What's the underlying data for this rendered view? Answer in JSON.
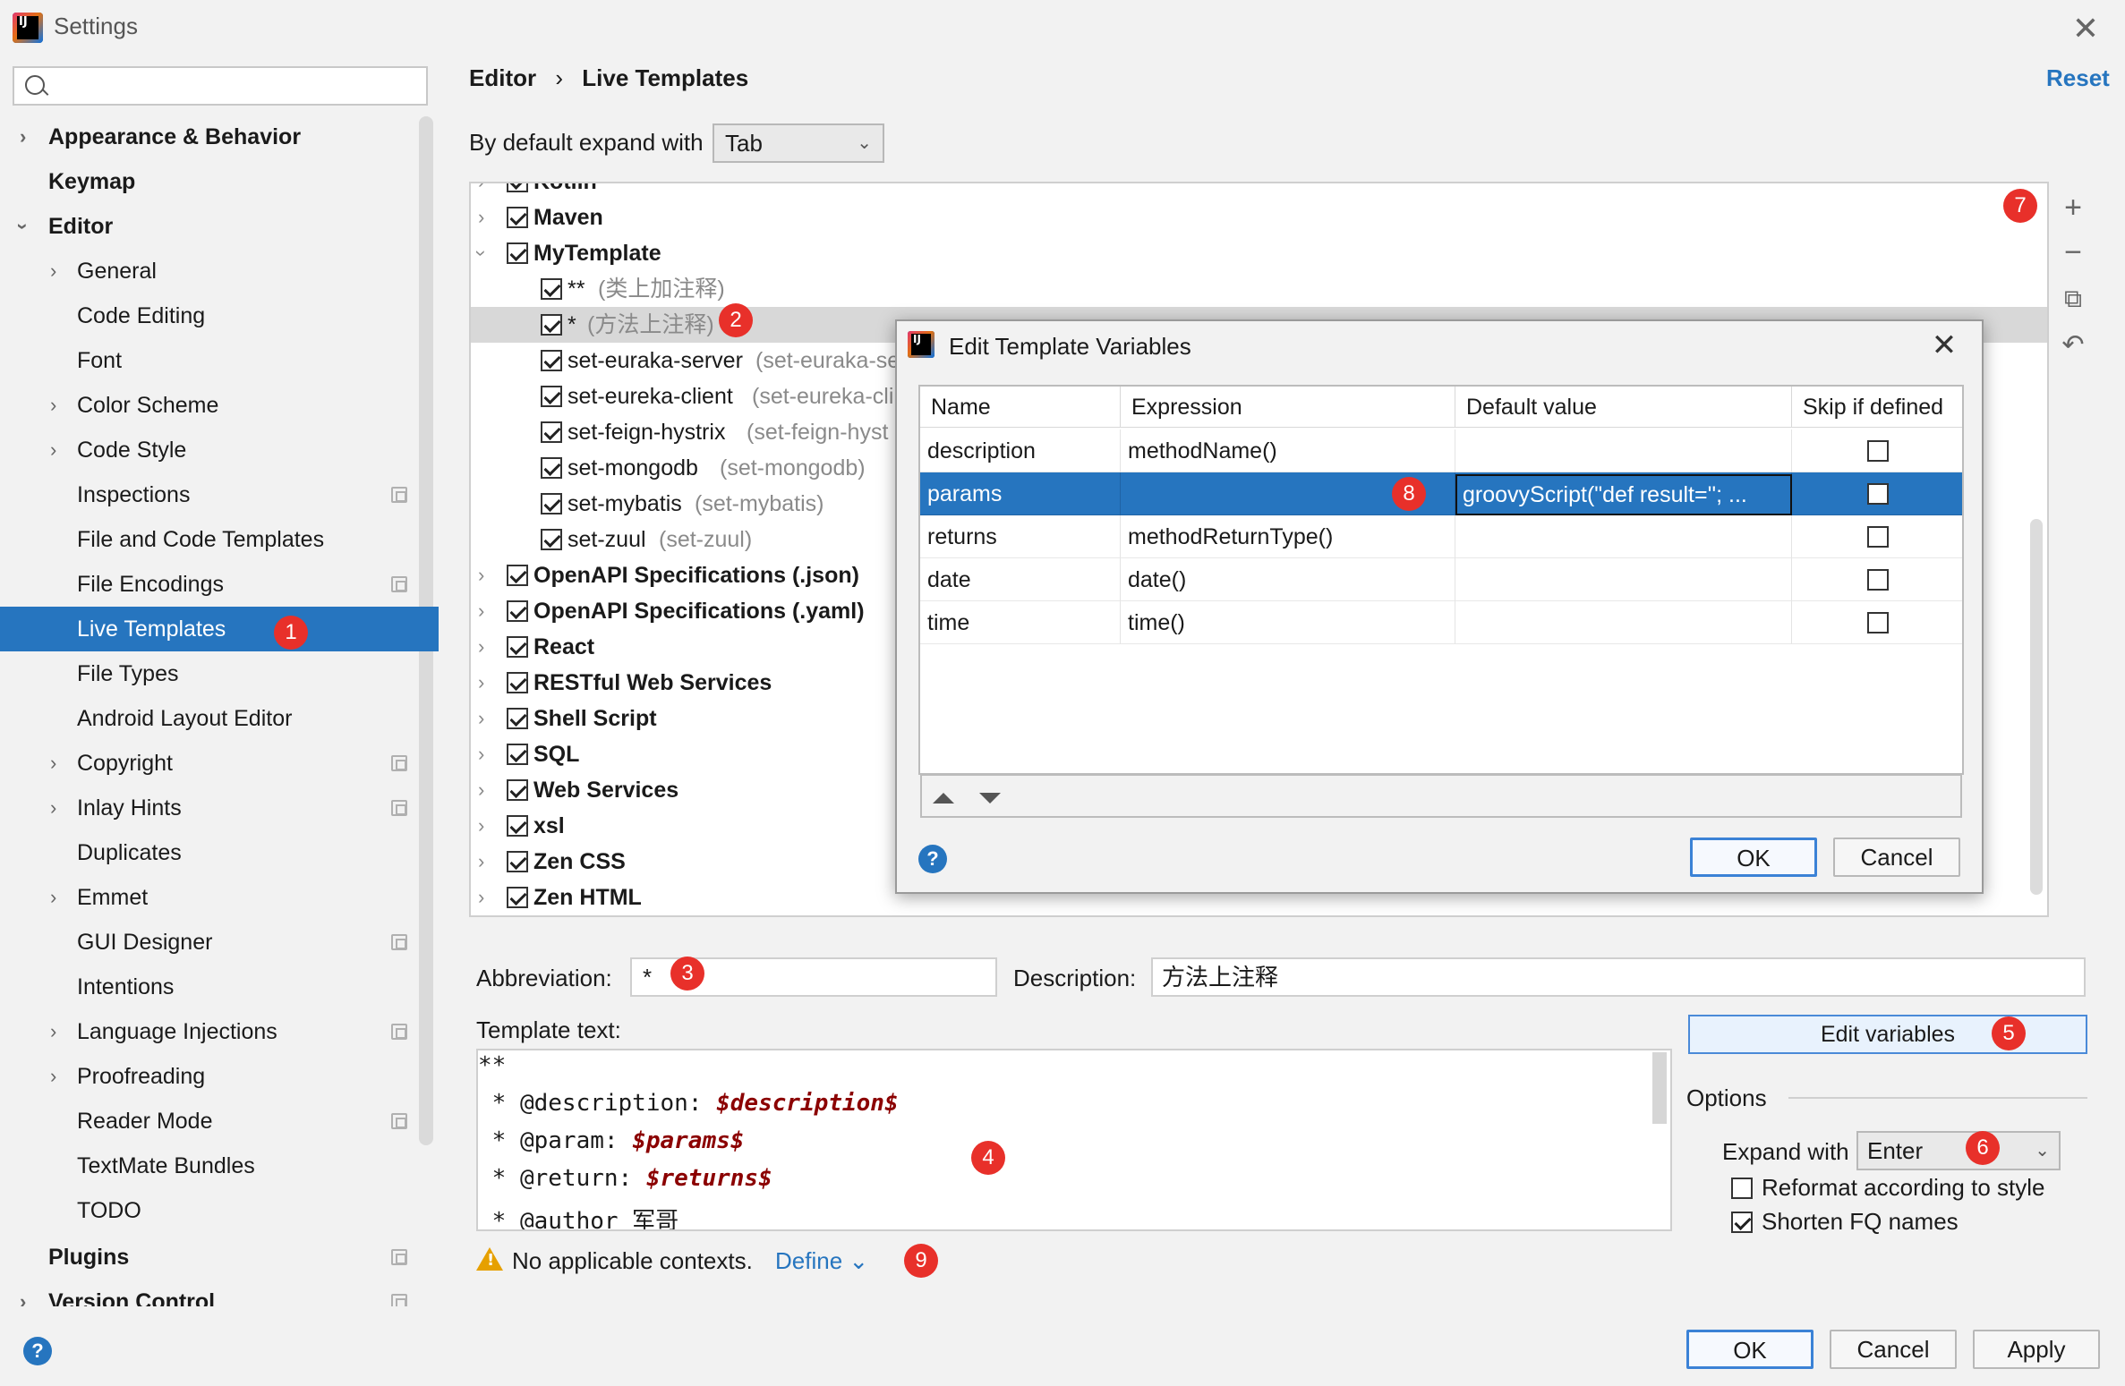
{
  "window": {
    "title": "Settings"
  },
  "search": {
    "placeholder": ""
  },
  "sidebar": {
    "items": [
      {
        "label": "Appearance & Behavior"
      },
      {
        "label": "Keymap"
      },
      {
        "label": "Editor"
      },
      {
        "label": "General"
      },
      {
        "label": "Code Editing"
      },
      {
        "label": "Font"
      },
      {
        "label": "Color Scheme"
      },
      {
        "label": "Code Style"
      },
      {
        "label": "Inspections"
      },
      {
        "label": "File and Code Templates"
      },
      {
        "label": "File Encodings"
      },
      {
        "label": "Live Templates"
      },
      {
        "label": "File Types"
      },
      {
        "label": "Android Layout Editor"
      },
      {
        "label": "Copyright"
      },
      {
        "label": "Inlay Hints"
      },
      {
        "label": "Duplicates"
      },
      {
        "label": "Emmet"
      },
      {
        "label": "GUI Designer"
      },
      {
        "label": "Intentions"
      },
      {
        "label": "Language Injections"
      },
      {
        "label": "Proofreading"
      },
      {
        "label": "Reader Mode"
      },
      {
        "label": "TextMate Bundles"
      },
      {
        "label": "TODO"
      },
      {
        "label": "Plugins"
      },
      {
        "label": "Version Control"
      }
    ]
  },
  "header": {
    "crumb1": "Editor",
    "sep": "›",
    "crumb2": "Live Templates",
    "reset": "Reset"
  },
  "expand": {
    "label": "By default expand with",
    "value": "Tab"
  },
  "tree": {
    "partial_top": "Kotlin",
    "groups": [
      {
        "label": "Maven"
      },
      {
        "label": "MyTemplate"
      }
    ],
    "templates": [
      {
        "abbr": "**",
        "desc": "(类上加注释)"
      },
      {
        "abbr": "*",
        "desc": "(方法上注释)"
      },
      {
        "abbr": "set-euraka-server",
        "desc": "(set-euraka-se"
      },
      {
        "abbr": "set-eureka-client",
        "desc": "(set-eureka-cli"
      },
      {
        "abbr": "set-feign-hystrix",
        "desc": "(set-feign-hyst"
      },
      {
        "abbr": "set-mongodb",
        "desc": "(set-mongodb)"
      },
      {
        "abbr": "set-mybatis",
        "desc": "(set-mybatis)"
      },
      {
        "abbr": "set-zuul",
        "desc": "(set-zuul)"
      }
    ],
    "groups_after": [
      {
        "label": "OpenAPI Specifications (.json)"
      },
      {
        "label": "OpenAPI Specifications (.yaml)"
      },
      {
        "label": "React"
      },
      {
        "label": "RESTful Web Services"
      },
      {
        "label": "Shell Script"
      },
      {
        "label": "SQL"
      },
      {
        "label": "Web Services"
      },
      {
        "label": "xsl"
      },
      {
        "label": "Zen CSS"
      },
      {
        "label": "Zen HTML"
      }
    ]
  },
  "toolbar": {
    "add": "+",
    "remove": "−",
    "copy": "⧉",
    "restore": "↶"
  },
  "abbreviation": {
    "label": "Abbreviation:",
    "value": "*"
  },
  "description": {
    "label": "Description:",
    "value": "方法上注释"
  },
  "template_text": {
    "label": "Template text:",
    "lines": [
      {
        "pre": "**",
        "var": ""
      },
      {
        "pre": " * @description: ",
        "var": "$description$"
      },
      {
        "pre": " * @param: ",
        "var": "$params$"
      },
      {
        "pre": " * @return: ",
        "var": "$returns$"
      },
      {
        "pre": " * @author 军哥",
        "var": ""
      }
    ]
  },
  "contexts": {
    "text": "No applicable contexts.",
    "define": "Define ⌄"
  },
  "edit_variables": {
    "label": "Edit variables"
  },
  "options": {
    "title": "Options",
    "expand_label": "Expand with",
    "expand_value": "Enter",
    "reformat": "Reformat according to style",
    "shorten": "Shorten FQ names"
  },
  "buttons": {
    "ok": "OK",
    "cancel": "Cancel",
    "apply": "Apply",
    "help": "?"
  },
  "dialog": {
    "title": "Edit Template Variables",
    "close": "✕",
    "columns": [
      "Name",
      "Expression",
      "Default value",
      "Skip if defined"
    ],
    "rows": [
      {
        "name": "description",
        "expression": "methodName()",
        "default": ""
      },
      {
        "name": "params",
        "expression": "",
        "default": "groovyScript(\"def result=''; ..."
      },
      {
        "name": "returns",
        "expression": "methodReturnType()",
        "default": ""
      },
      {
        "name": "date",
        "expression": "date()",
        "default": ""
      },
      {
        "name": "time",
        "expression": "time()",
        "default": ""
      }
    ],
    "ok": "OK",
    "cancel": "Cancel",
    "help": "?"
  },
  "badges": [
    "1",
    "2",
    "3",
    "4",
    "5",
    "6",
    "7",
    "8",
    "9"
  ],
  "colors": {
    "accent": "#2675bf",
    "badge": "#e8302a",
    "variable": "#8b0000"
  }
}
